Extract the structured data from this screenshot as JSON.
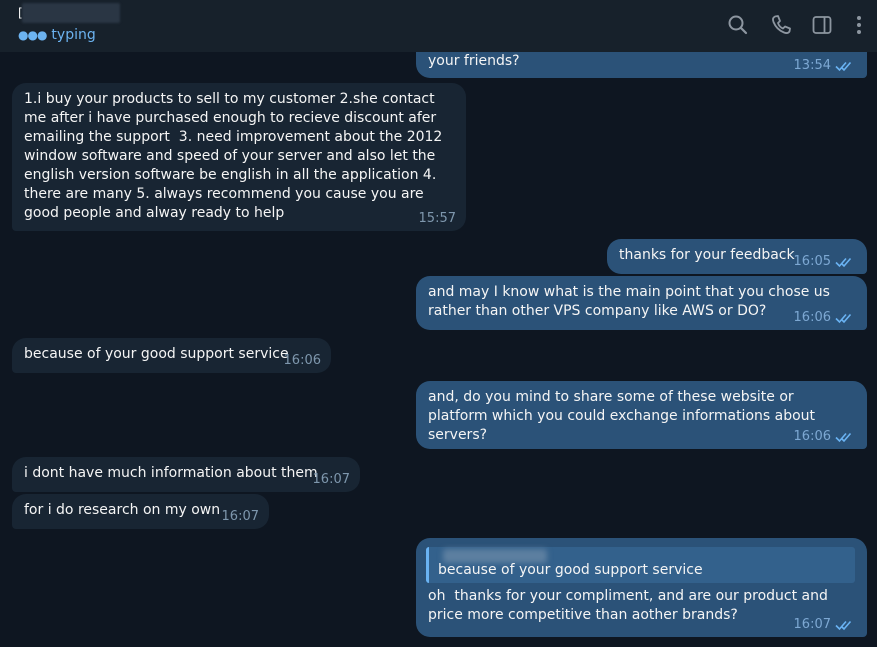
{
  "header": {
    "chat_name": "[",
    "status": "typing",
    "icons": [
      "search-icon",
      "phone-icon",
      "sidebar-toggle-icon",
      "more-vertical-icon"
    ]
  },
  "colors": {
    "background": "#0e1621",
    "header": "#17212b",
    "incoming_bubble": "#182533",
    "outgoing_bubble": "#2b5278",
    "accent": "#6ab3f3"
  },
  "messages": [
    {
      "direction": "out",
      "text": "your friends?",
      "time": "13:54",
      "read": true
    },
    {
      "direction": "in",
      "text": "1.i buy your products to sell to my customer 2.she contact me after i have purchased enough to recieve discount afer emailing the support  3. need improvement about the 2012 window software and speed of your server and also let the english version software be english in all the application 4. there are many 5. always recommend you cause you are good people and alway ready to help",
      "time": "15:57"
    },
    {
      "direction": "out",
      "text": "thanks for your feedback",
      "time": "16:05",
      "read": true
    },
    {
      "direction": "out",
      "text": "and may I know what is the main point that you chose us rather than other VPS company like AWS or DO?",
      "time": "16:06",
      "read": true
    },
    {
      "direction": "in",
      "text": "because of your good support service",
      "time": "16:06"
    },
    {
      "direction": "out",
      "text": "and, do you mind to share some of these website or platform which you could exchange informations about servers?",
      "time": "16:06",
      "read": true
    },
    {
      "direction": "in",
      "text": "i dont have much information about them",
      "time": "16:07"
    },
    {
      "direction": "in",
      "text": "for i do research on my own",
      "time": "16:07"
    },
    {
      "direction": "out",
      "reply_to": "because of your good support service",
      "text": "oh  thanks for your compliment, and are our product and price more competitive than aother brands?",
      "time": "16:07",
      "read": true
    }
  ]
}
